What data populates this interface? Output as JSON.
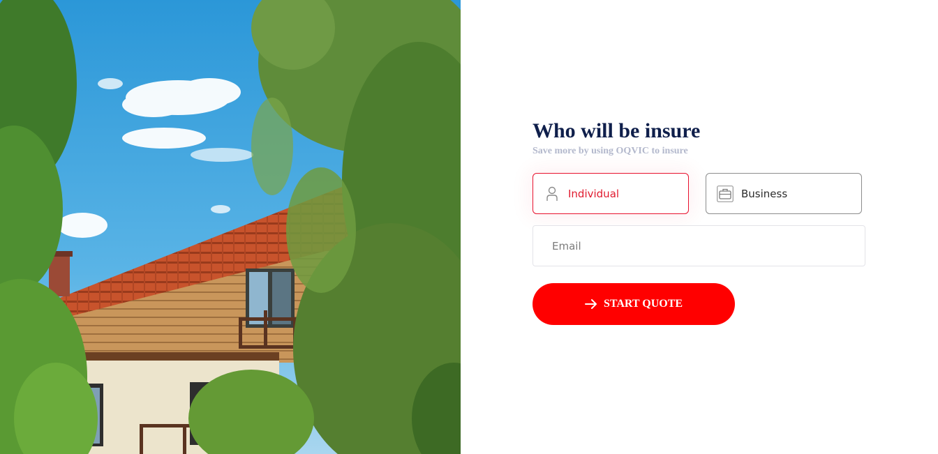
{
  "hero": {
    "image_subject": "house-with-tiled-roof-and-trees"
  },
  "form": {
    "title": "Who will be insure",
    "subtitle": "Save more by using OQVIC to insure",
    "insurance_types": [
      {
        "label": "Individual",
        "icon": "person-icon",
        "selected": true
      },
      {
        "label": "Business",
        "icon": "briefcase-icon",
        "selected": false
      }
    ],
    "email": {
      "placeholder": "Email",
      "value": ""
    },
    "cta": {
      "label": "START QUOTE",
      "icon": "arrow-right-icon"
    }
  },
  "colors": {
    "accent": "#ff0000",
    "selected_border": "#e8112d",
    "title": "#0f1f4b",
    "subtitle": "#b3b8cc"
  }
}
